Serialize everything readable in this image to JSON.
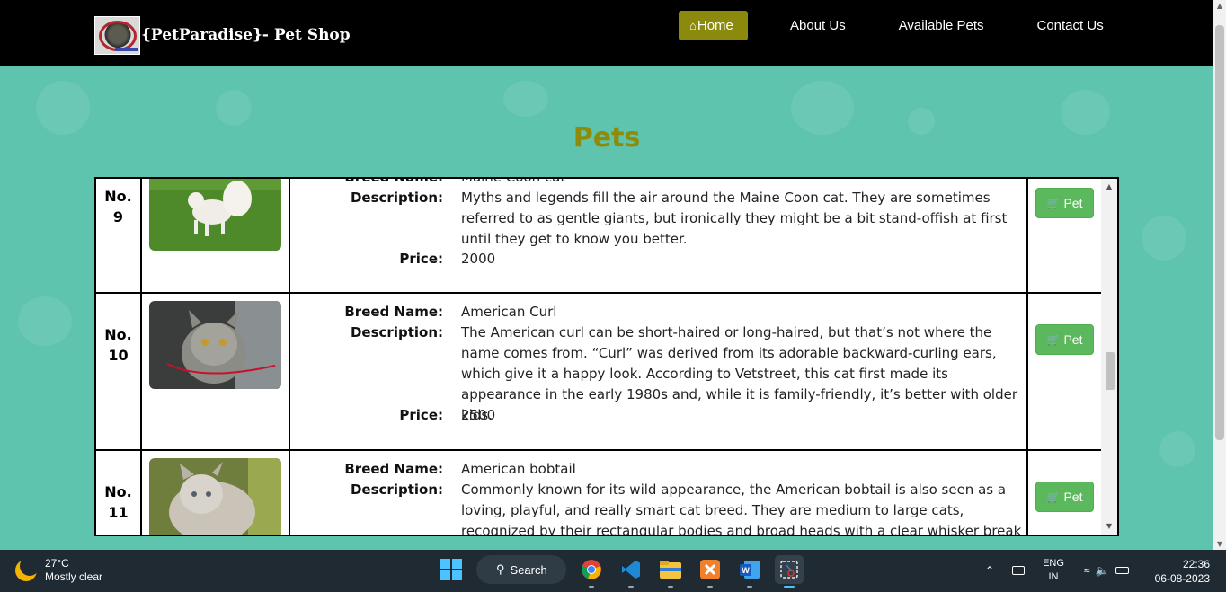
{
  "navbar": {
    "brand_text": "{PetParadise}- Pet Shop",
    "links": [
      {
        "label": "Home",
        "active": true
      },
      {
        "label": "About Us",
        "active": false
      },
      {
        "label": "Available Pets",
        "active": false
      },
      {
        "label": "Contact Us",
        "active": false
      }
    ]
  },
  "page_title": "Pets",
  "labels": {
    "breed": "Breed Name:",
    "description": "Description:",
    "price": "Price:",
    "pet_button": "Pet"
  },
  "pets": [
    {
      "num": "No. 9",
      "num_line1": "No.",
      "num_line2": "9",
      "breed_partial": "Maine Coon cat",
      "description": "Myths and legends fill the air around the Maine Coon cat. They are sometimes referred to as gentle giants, but ironically they might be a bit stand-offish at first until they get to know you better.",
      "price": "2000",
      "image": "white-fluffy-cat-on-grass"
    },
    {
      "num": "No. 10",
      "num_line1": "No.",
      "num_line2": "10",
      "breed": "American Curl",
      "description": "The American curl can be short-haired or long-haired, but that’s not where the name comes from. “Curl” was derived from its adorable backward-curling ears, which give it a happy look. According to Vetstreet, this cat first made its appearance in the early 1980s and, while it is family-friendly, it’s better with older kids.",
      "price": "2500",
      "image": "grey-tabby-curl-cat"
    },
    {
      "num": "No. 11",
      "num_line1": "No.",
      "num_line2": "11",
      "breed": "American bobtail",
      "description": "Commonly known for its wild appearance, the American bobtail is also seen as a loving, playful, and really smart cat breed. They are medium to large cats, recognized by their rectangular bodies and broad heads with a clear whisker break",
      "image": "fluffy-grey-bobtail-cat"
    }
  ],
  "taskbar": {
    "temperature": "27°C",
    "weather": "Mostly clear",
    "search_label": "Search",
    "lang_top": "ENG",
    "lang_bottom": "IN",
    "time": "22:36",
    "date": "06-08-2023",
    "apps": [
      "chrome-icon",
      "vscode-icon",
      "file-explorer-icon",
      "xampp-icon",
      "word-icon",
      "snipping-tool-icon"
    ]
  }
}
